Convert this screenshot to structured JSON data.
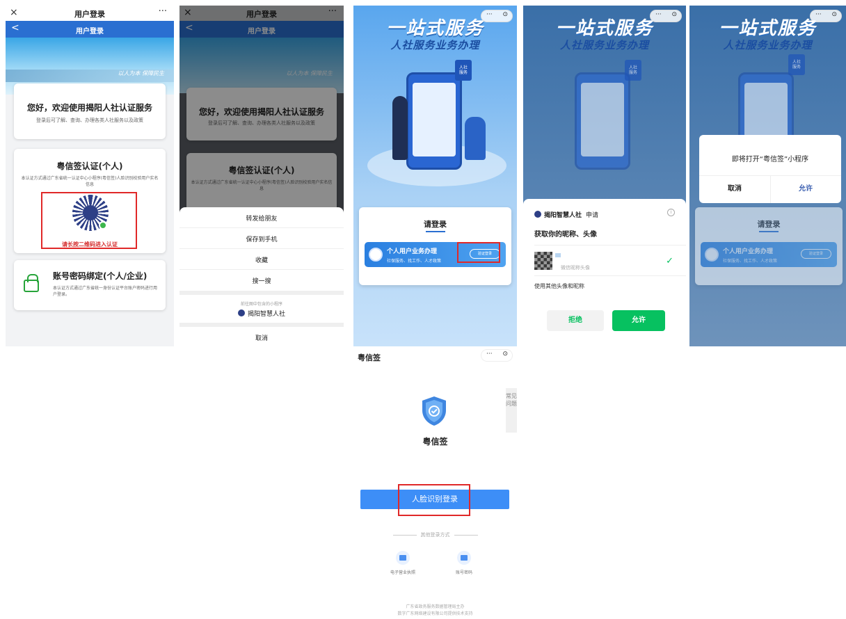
{
  "panel1": {
    "close_glyph": "×",
    "title": "用户登录",
    "more_glyph": "···",
    "back_glyph": "<",
    "nav_title": "用户登录",
    "slogan": "以人为本 保障民生",
    "welcome_title": "您好，欢迎使用揭阳人社认证服务",
    "welcome_sub": "登录后可了解、查询、办理各类人社服务以及政策",
    "sign_title": "粤信签认证(个人)",
    "sign_desc": "本认证方式通过广东省统一认证中心小程序(粤信签)人脸识别校验用户实名信息",
    "qr_tip": "请长按二维码进入认证",
    "account_title": "账号密码绑定(个人/企业)",
    "account_desc": "本认证方式通过广东省统一身份认证平台账户密码进行用户登录。"
  },
  "panel2": {
    "close_glyph": "×",
    "title": "用户登录",
    "more_glyph": "···",
    "back_glyph": "<",
    "nav_title": "用户登录",
    "slogan": "以人为本 保障民生",
    "welcome_title": "您好，欢迎使用揭阳人社认证服务",
    "welcome_sub": "登录后可了解、查询、办理各类人社服务以及政策",
    "sign_title": "粤信签认证(个人)",
    "sign_desc": "本认证方式通过广东省统一认证中心小程序(粤信签)人脸识别校验用户实名信息",
    "menu": [
      "转发给朋友",
      "保存到手机",
      "收藏",
      "搜一搜"
    ],
    "mini_hint": "前往图中包含的小程序",
    "mini_app": "揭阳智慧人社",
    "cancel": "取消"
  },
  "panel3": {
    "capsule_dots": "···",
    "capsule_circle": "⊙",
    "title1": "一站式服务",
    "title2": "人社服务业务办理",
    "badge": "人社\n服务",
    "login_heading": "请登录",
    "service_title": "个人用户业务办理",
    "service_sub": "社保服务、找工作、人才政策",
    "verify_btn": "验证登录"
  },
  "panel4": {
    "capsule_dots": "···",
    "capsule_circle": "⊙",
    "title1": "一站式服务",
    "title2": "人社服务业务办理",
    "badge": "人社\n服务",
    "app_name": "揭阳智慧人社",
    "request": "申请",
    "info_glyph": "i",
    "question": "获取你的昵称、头像",
    "nickname_hint": "微信昵称头像",
    "check_glyph": "✓",
    "other": "使用其他头像和昵称",
    "refuse": "拒绝",
    "allow": "允许"
  },
  "panel5": {
    "capsule_dots": "···",
    "capsule_circle": "⊙",
    "title1": "一站式服务",
    "title2": "人社服务业务办理",
    "badge": "人社\n服务",
    "modal_text": "即将打开“粤信签”小程序",
    "cancel": "取消",
    "allow": "允许",
    "login_heading": "请登录",
    "service_title": "个人用户业务办理",
    "service_sub": "社保服务、找工作、人才政策",
    "verify_btn": "验证登录"
  },
  "panel6": {
    "title": "粤信签",
    "capsule_dots": "···",
    "capsule_circle": "⊙",
    "faq": "常见问题",
    "app_name": "粤信签",
    "face_login": "人脸识别登录",
    "other_methods": "其他登录方式",
    "option1": "电子营业执照",
    "option2": "账号密码",
    "footer1": "广东省政务服务数据管理局主办",
    "footer2": "数字广东网络建设有限公司提供技术支持"
  }
}
